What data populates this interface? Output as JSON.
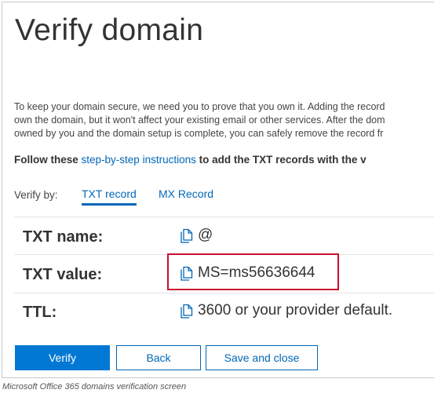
{
  "page": {
    "title": "Verify domain",
    "intro_lines": [
      "To keep your domain secure, we need you to prove that you own it. Adding the record",
      "own the domain, but it won't affect your existing email or other services. After the dom",
      "owned by you and the domain setup is complete, you can safely remove the record fr"
    ],
    "follow_prefix": "Follow these",
    "follow_link": "step-by-step instructions",
    "follow_suffix": "to add the TXT records with the v"
  },
  "verify_by": {
    "label": "Verify by:",
    "tabs": [
      {
        "label": "TXT record",
        "active": true
      },
      {
        "label": "MX Record",
        "active": false
      }
    ]
  },
  "records": [
    {
      "label": "TXT name:",
      "value": "@"
    },
    {
      "label": "TXT value:",
      "value": "MS=ms56636644"
    },
    {
      "label": "TTL:",
      "value": "3600 or your provider default."
    }
  ],
  "buttons": {
    "verify": "Verify",
    "back": "Back",
    "save_close": "Save and close"
  },
  "caption": "Microsoft Office 365 domains verification screen",
  "colors": {
    "accent": "#0078d4",
    "link": "#0067b8",
    "highlight": "#c8102e"
  },
  "icons": {
    "copy": "copy-icon"
  }
}
